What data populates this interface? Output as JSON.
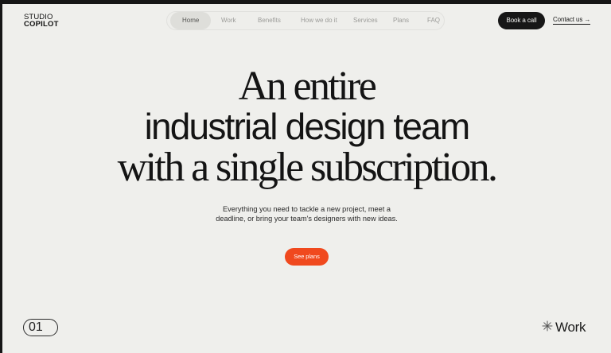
{
  "logo": {
    "line1": "STUDIO",
    "line2": "COPILOT"
  },
  "nav": {
    "items": [
      {
        "label": "Home",
        "active": true
      },
      {
        "label": "Work",
        "active": false
      },
      {
        "label": "Benefits",
        "active": false
      },
      {
        "label": "How we do it",
        "active": false
      },
      {
        "label": "Services",
        "active": false
      },
      {
        "label": "Plans",
        "active": false
      },
      {
        "label": "FAQ",
        "active": false
      }
    ]
  },
  "header": {
    "book_call_label": "Book a call",
    "contact_label": "Contact us →"
  },
  "hero": {
    "line1": "An entire",
    "line2": "industrial design team",
    "line3": "with a single subscription.",
    "subtitle_line1": "Everything you need to tackle a new project, meet a",
    "subtitle_line2": "deadline, or bring your team's designers with new ideas.",
    "cta_label": "See plans"
  },
  "footer": {
    "counter": "01",
    "section_label": "Work"
  },
  "colors": {
    "background": "#efefec",
    "text": "#141414",
    "accent": "#f0491e",
    "dark_button": "#171717"
  },
  "icons": {
    "section_icon": "asterisk-icon"
  }
}
